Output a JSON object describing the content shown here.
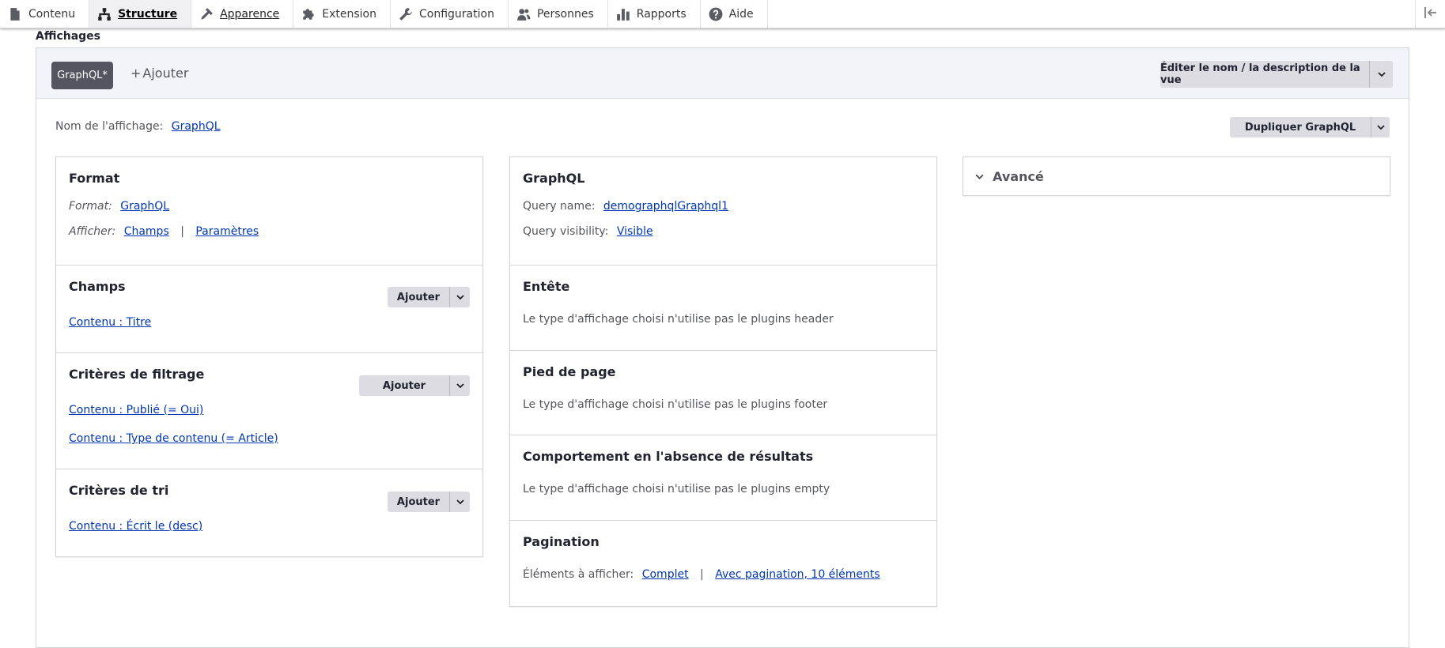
{
  "toolbar": {
    "items": [
      {
        "label": "Contenu",
        "icon": "page-icon"
      },
      {
        "label": "Structure",
        "icon": "structure-icon"
      },
      {
        "label": "Apparence",
        "icon": "brush-icon"
      },
      {
        "label": "Extension",
        "icon": "puzzle-icon"
      },
      {
        "label": "Configuration",
        "icon": "wrench-icon"
      },
      {
        "label": "Personnes",
        "icon": "people-icon"
      },
      {
        "label": "Rapports",
        "icon": "bar-chart-icon"
      },
      {
        "label": "Aide",
        "icon": "help-icon"
      }
    ],
    "active": "Structure"
  },
  "section_title": "Affichages",
  "tabs": {
    "active_label": "GraphQL*",
    "add_label": "Ajouter",
    "add_symbol": "+"
  },
  "edit_button": "Éditer le nom / la description de la vue",
  "display_name": {
    "label": "Nom de l'affichage:",
    "value": "GraphQL"
  },
  "duplicate_button": "Dupliquer GraphQL",
  "left_column": {
    "format": {
      "title": "Format",
      "format_label": "Format:",
      "format_value": "GraphQL",
      "show_label": "Afficher:",
      "show_fields": "Champs",
      "show_separator": "|",
      "show_settings": "Paramètres"
    },
    "fields": {
      "title": "Champs",
      "add_label": "Ajouter",
      "items": [
        "Contenu : Titre"
      ]
    },
    "filters": {
      "title": "Critères de filtrage",
      "add_label": "Ajouter",
      "items": [
        "Contenu : Publié (= Oui)",
        "Contenu : Type de contenu (= Article)"
      ]
    },
    "sorts": {
      "title": "Critères de tri",
      "add_label": "Ajouter",
      "items": [
        "Contenu : Écrit le (desc)"
      ]
    }
  },
  "middle_column": {
    "graphql": {
      "title": "GraphQL",
      "query_name_label": "Query name:",
      "query_name_value": "demographqlGraphql1",
      "query_visibility_label": "Query visibility:",
      "query_visibility_value": "Visible"
    },
    "header": {
      "title": "Entête",
      "note": "Le type d'affichage choisi n'utilise pas le plugins header"
    },
    "footer": {
      "title": "Pied de page",
      "note": "Le type d'affichage choisi n'utilise pas le plugins footer"
    },
    "empty": {
      "title": "Comportement en l'absence de résultats",
      "note": "Le type d'affichage choisi n'utilise pas le plugins empty"
    },
    "pager": {
      "title": "Pagination",
      "items_label": "Éléments à afficher:",
      "items_value": "Complet",
      "separator": "|",
      "pager_value": "Avec pagination, 10 éléments"
    }
  },
  "advanced": {
    "title": "Avancé"
  },
  "colors": {
    "link": "#0036b1",
    "active_tab": "#545560",
    "button_bg": "#dcdce2",
    "tabbar_bg": "#f3f4f9"
  }
}
